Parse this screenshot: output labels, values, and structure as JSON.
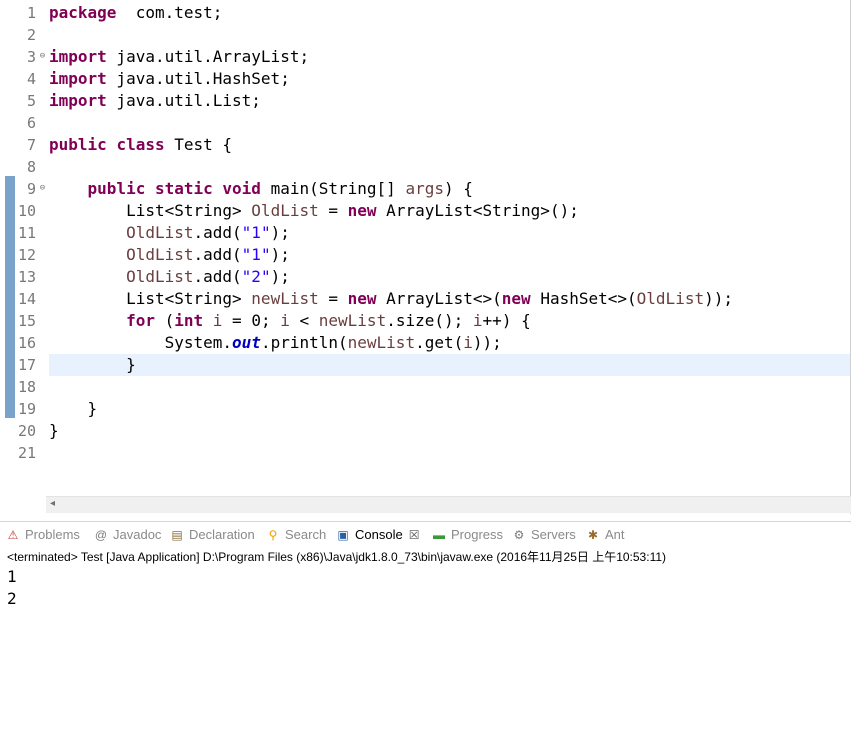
{
  "editor": {
    "lines": [
      {
        "n": "1",
        "segs": [
          [
            "kw",
            "package"
          ],
          [
            "",
            "  com.test;"
          ]
        ]
      },
      {
        "n": "2",
        "segs": []
      },
      {
        "n": "3",
        "segs": [
          [
            "kw",
            "import"
          ],
          [
            "",
            " java.util.ArrayList;"
          ]
        ]
      },
      {
        "n": "4",
        "segs": [
          [
            "kw",
            "import"
          ],
          [
            "",
            " java.util.HashSet;"
          ]
        ]
      },
      {
        "n": "5",
        "segs": [
          [
            "kw",
            "import"
          ],
          [
            "",
            " java.util.List;"
          ]
        ]
      },
      {
        "n": "6",
        "segs": []
      },
      {
        "n": "7",
        "segs": [
          [
            "kw",
            "public"
          ],
          [
            "",
            " "
          ],
          [
            "kw",
            "class"
          ],
          [
            "",
            " Test {"
          ]
        ]
      },
      {
        "n": "8",
        "segs": []
      },
      {
        "n": "9",
        "segs": [
          [
            "",
            "    "
          ],
          [
            "kw",
            "public"
          ],
          [
            "",
            " "
          ],
          [
            "kw",
            "static"
          ],
          [
            "",
            " "
          ],
          [
            "kw",
            "void"
          ],
          [
            "",
            " main(String[] "
          ],
          [
            "var",
            "args"
          ],
          [
            "",
            ") {"
          ]
        ]
      },
      {
        "n": "10",
        "segs": [
          [
            "",
            "        List<String> "
          ],
          [
            "var",
            "OldList"
          ],
          [
            "",
            " = "
          ],
          [
            "kw",
            "new"
          ],
          [
            "",
            " ArrayList<String>();"
          ]
        ]
      },
      {
        "n": "11",
        "segs": [
          [
            "",
            "        "
          ],
          [
            "var",
            "OldList"
          ],
          [
            "",
            ".add("
          ],
          [
            "str",
            "\"1\""
          ],
          [
            "",
            ");"
          ]
        ]
      },
      {
        "n": "12",
        "segs": [
          [
            "",
            "        "
          ],
          [
            "var",
            "OldList"
          ],
          [
            "",
            ".add("
          ],
          [
            "str",
            "\"1\""
          ],
          [
            "",
            ");"
          ]
        ]
      },
      {
        "n": "13",
        "segs": [
          [
            "",
            "        "
          ],
          [
            "var",
            "OldList"
          ],
          [
            "",
            ".add("
          ],
          [
            "str",
            "\"2\""
          ],
          [
            "",
            ");"
          ]
        ]
      },
      {
        "n": "14",
        "segs": [
          [
            "",
            "        List<String> "
          ],
          [
            "var",
            "newList"
          ],
          [
            "",
            " = "
          ],
          [
            "kw",
            "new"
          ],
          [
            "",
            " ArrayList<>("
          ],
          [
            "kw",
            "new"
          ],
          [
            "",
            " HashSet<>("
          ],
          [
            "var",
            "OldList"
          ],
          [
            "",
            "));"
          ]
        ]
      },
      {
        "n": "15",
        "segs": [
          [
            "",
            "        "
          ],
          [
            "kw",
            "for"
          ],
          [
            "",
            " ("
          ],
          [
            "kw",
            "int"
          ],
          [
            "",
            " "
          ],
          [
            "var",
            "i"
          ],
          [
            "",
            " = 0; "
          ],
          [
            "var",
            "i"
          ],
          [
            "",
            " < "
          ],
          [
            "var",
            "newList"
          ],
          [
            "",
            ".size(); "
          ],
          [
            "var",
            "i"
          ],
          [
            "",
            "++) {"
          ]
        ]
      },
      {
        "n": "16",
        "segs": [
          [
            "",
            "            System."
          ],
          [
            "fld",
            "out"
          ],
          [
            "",
            ".println("
          ],
          [
            "var",
            "newList"
          ],
          [
            "",
            ".get("
          ],
          [
            "var",
            "i"
          ],
          [
            "",
            "));"
          ]
        ]
      },
      {
        "n": "17",
        "segs": [
          [
            "",
            "        }"
          ]
        ],
        "current": true
      },
      {
        "n": "18",
        "segs": []
      },
      {
        "n": "19",
        "segs": [
          [
            "",
            "    }"
          ]
        ]
      },
      {
        "n": "20",
        "segs": [
          [
            "",
            "}"
          ]
        ]
      },
      {
        "n": "21",
        "segs": []
      }
    ],
    "fold_markers": [
      "3",
      "9"
    ],
    "scroll_left_glyph": "◂"
  },
  "tabs": [
    {
      "id": "problems",
      "label": "Problems",
      "icon": "problems-icon",
      "glyph": "⚠",
      "color": "#c0392b"
    },
    {
      "id": "javadoc",
      "label": "Javadoc",
      "icon": "at-icon",
      "glyph": "@",
      "color": "#7a7a7a"
    },
    {
      "id": "declaration",
      "label": "Declaration",
      "icon": "declaration-icon",
      "glyph": "▤",
      "color": "#8a6d3b"
    },
    {
      "id": "search",
      "label": "Search",
      "icon": "search-icon",
      "glyph": "⚲",
      "color": "#f0a000"
    },
    {
      "id": "console",
      "label": "Console",
      "icon": "console-icon",
      "glyph": "▣",
      "color": "#2a62a7",
      "active": true,
      "close": "☒"
    },
    {
      "id": "progress",
      "label": "Progress",
      "icon": "progress-icon",
      "glyph": "▬",
      "color": "#3a9a3a"
    },
    {
      "id": "servers",
      "label": "Servers",
      "icon": "servers-icon",
      "glyph": "⚙",
      "color": "#7a7a7a"
    },
    {
      "id": "ant",
      "label": "Ant",
      "icon": "ant-icon",
      "glyph": "✱",
      "color": "#9a6a2a"
    }
  ],
  "console": {
    "header": "<terminated> Test [Java Application] D:\\Program Files (x86)\\Java\\jdk1.8.0_73\\bin\\javaw.exe (2016年11月25日 上午10:53:11)",
    "output": [
      "1",
      "2"
    ]
  }
}
